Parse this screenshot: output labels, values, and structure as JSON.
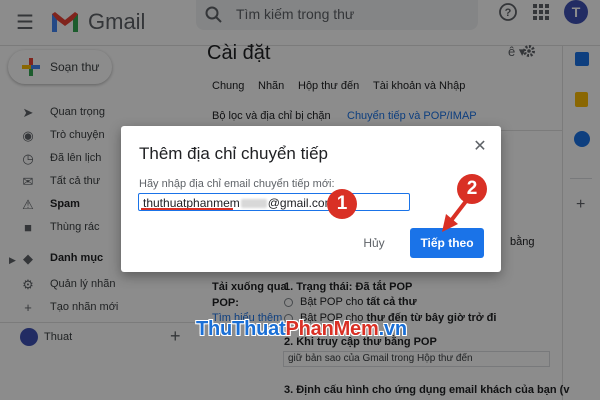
{
  "header": {
    "app_name": "Gmail",
    "search_placeholder": "Tìm kiếm trong thư",
    "avatar_letter": "T"
  },
  "sidebar": {
    "compose_label": "Soạn thư",
    "items": [
      {
        "label": "Quan trọng",
        "icon": "label-important-icon"
      },
      {
        "label": "Trò chuyện",
        "icon": "chat-icon"
      },
      {
        "label": "Đã lên lịch",
        "icon": "schedule-icon"
      },
      {
        "label": "Tất cả thư",
        "icon": "all-mail-icon"
      },
      {
        "label": "Spam",
        "icon": "spam-icon"
      },
      {
        "label": "Thùng rác",
        "icon": "trash-icon"
      },
      {
        "label": "Danh mục",
        "icon": "category-icon"
      },
      {
        "label": "Quản lý nhãn",
        "icon": "manage-labels-icon"
      },
      {
        "label": "Tạo nhãn mới",
        "icon": "plus-icon"
      }
    ],
    "user_name": "Thuat"
  },
  "settings": {
    "title": "Cài đặt",
    "tabs_row1": [
      "Chung",
      "Nhãn",
      "Hộp thư đến",
      "Tài khoản và Nhập"
    ],
    "tabs_row2": [
      "Bộ lọc và địa chỉ bị chặn",
      "Chuyển tiếp và POP/IMAP"
    ],
    "partial_text_right": "bằng",
    "pop_section_label": "Tải xuống qua",
    "pop_label": "POP:",
    "learn_more": "Tìm hiểu thêm",
    "status_line": "1. Trạng thái: Đã tắt POP",
    "option1_prefix": "Bật POP cho ",
    "option1_bold": "tất cả thư",
    "option2_prefix": "Bật POP cho ",
    "option2_bold": "thư đến từ bây giờ trở đi",
    "step2": "2. Khi truy cập thư bằng POP",
    "select_value": "giữ bản sao của Gmail trong Hộp thư đến",
    "step3": "3. Định cấu hình cho ứng dụng email khách của bạn (v"
  },
  "dialog": {
    "title": "Thêm địa chỉ chuyển tiếp",
    "prompt": "Hãy nhập địa chỉ email chuyển tiếp mới:",
    "input_prefix": "thuthuatphanmem",
    "input_suffix": "@gmail.com",
    "cancel_label": "Hủy",
    "next_label": "Tiếp theo"
  },
  "annotations": {
    "marker1": "1",
    "marker2": "2",
    "color": "#d93025"
  },
  "watermark": {
    "part1": "ThuThuat",
    "part2": "PhanMem",
    "part3": ".vn"
  },
  "colors": {
    "accent": "#1a73e8",
    "annotation": "#d93025"
  }
}
